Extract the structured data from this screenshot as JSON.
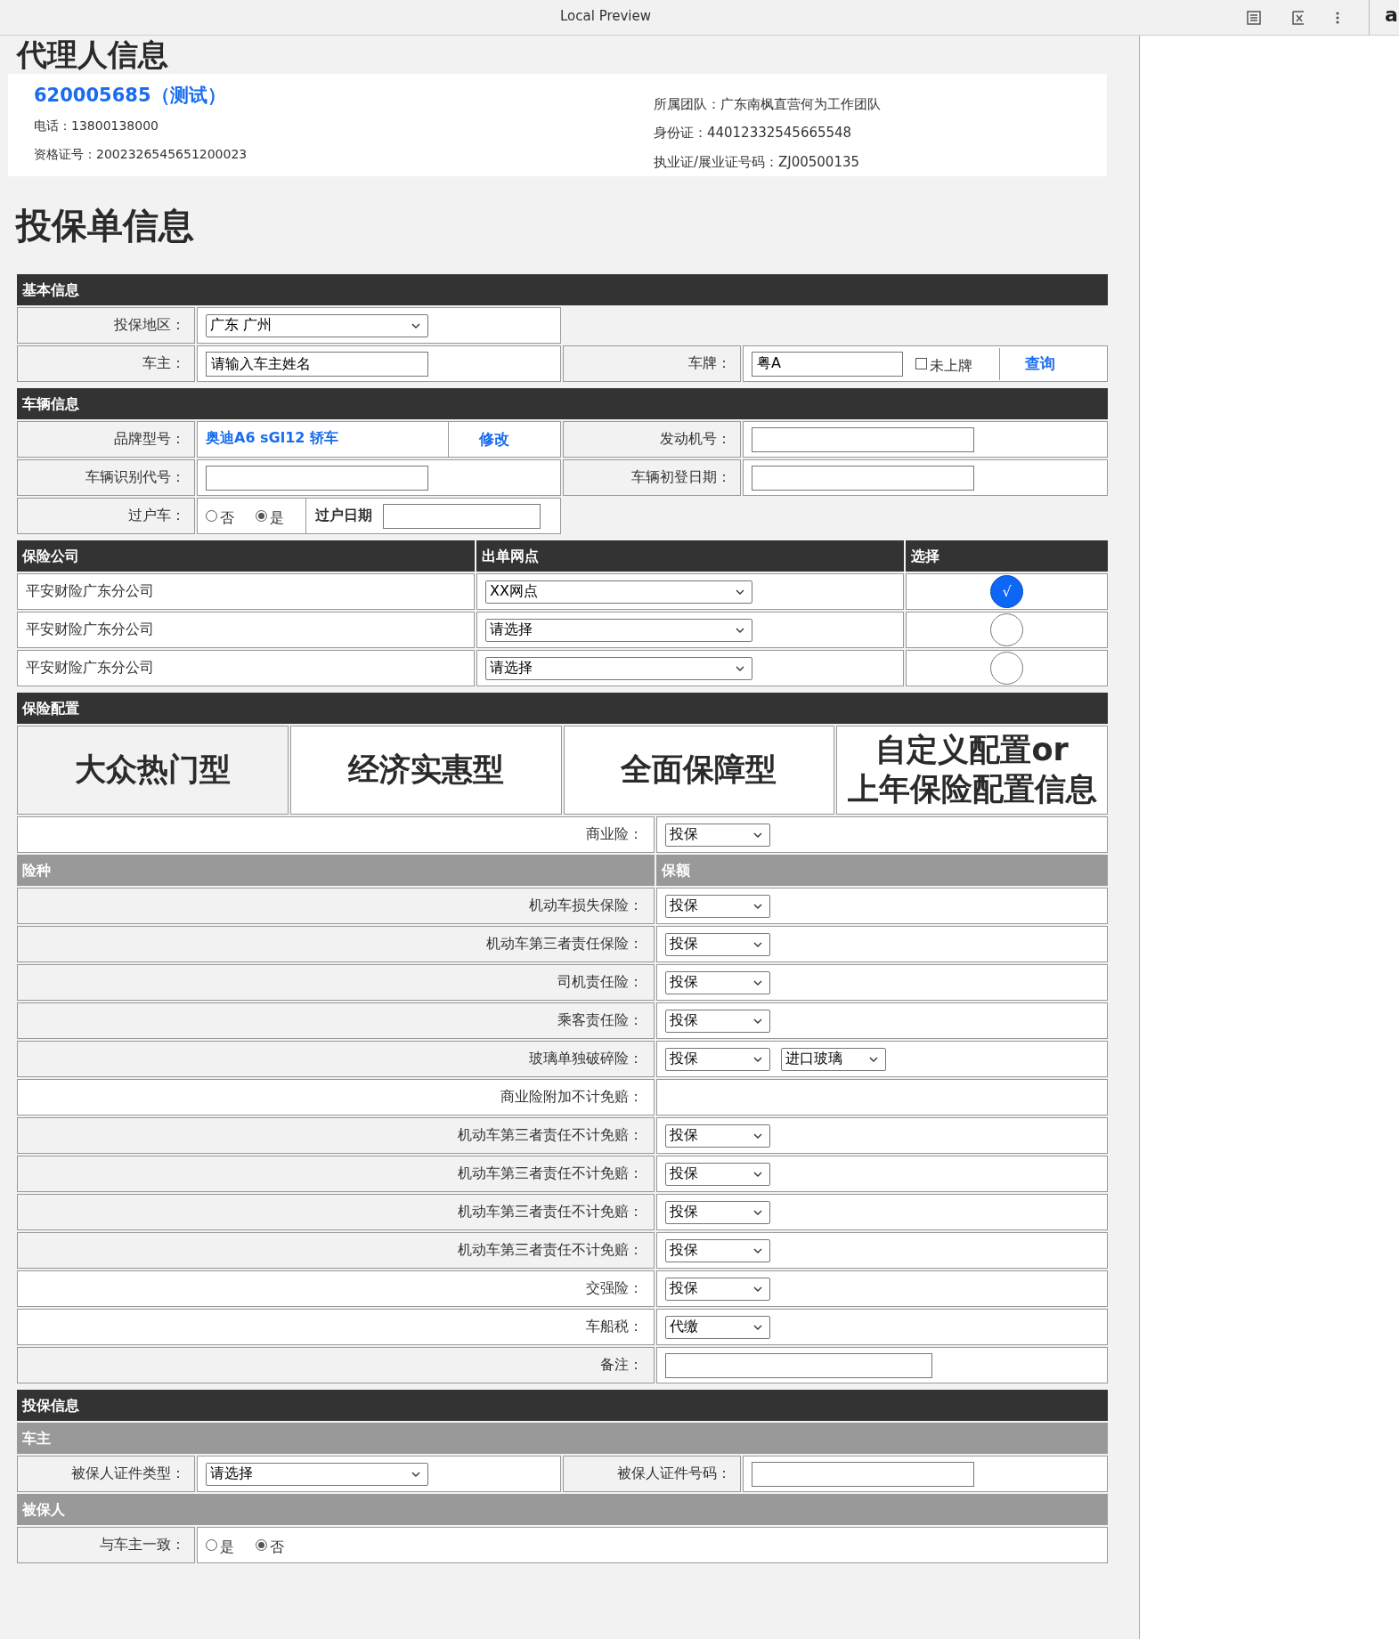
{
  "browser": {
    "title": "Local Preview",
    "avatar_letter": "a"
  },
  "agent": {
    "heading": "代理人信息",
    "name": "620005685（测试）",
    "left": [
      {
        "label": "电话：",
        "value": "13800138000"
      },
      {
        "label": "资格证号：",
        "value": "2002326545651200023"
      }
    ],
    "right": [
      {
        "label": "所属团队：",
        "value": "广东南枫直营何为工作团队"
      },
      {
        "label": "身份证：",
        "value": "44012332545665548"
      },
      {
        "label": "执业证/展业证号码：",
        "value": "ZJ00500135"
      }
    ]
  },
  "form_title": "投保单信息",
  "basic": {
    "header": "基本信息",
    "region": {
      "label": "投保地区：",
      "value": "广东 广州"
    },
    "owner": {
      "label": "车主：",
      "placeholder": "请输入车主姓名"
    },
    "plate": {
      "label": "车牌：",
      "value": "粤A",
      "unlicensed": {
        "label": "未上牌",
        "checked": false
      },
      "query": "查询"
    }
  },
  "vehicle": {
    "header": "车辆信息",
    "model": {
      "label": "品牌型号：",
      "value": "奥迪A6 sGl12 轿车",
      "edit": "修改"
    },
    "engine": {
      "label": "发动机号："
    },
    "vin": {
      "label": "车辆识别代号："
    },
    "reg_date": {
      "label": "车辆初登日期："
    },
    "transfer": {
      "label": "过户车：",
      "options": [
        {
          "label": "否",
          "selected": false
        },
        {
          "label": "是",
          "selected": true
        }
      ],
      "date_label": "过户日期"
    }
  },
  "companies": {
    "columns": [
      "保险公司",
      "出单网点",
      "选择"
    ],
    "mark": "√",
    "rows": [
      {
        "name": "平安财险广东分公司",
        "outlet": "XX网点",
        "selected": true
      },
      {
        "name": "平安财险广东分公司",
        "outlet": "请选择",
        "selected": false
      },
      {
        "name": "平安财险广东分公司",
        "outlet": "请选择",
        "selected": false
      }
    ]
  },
  "config": {
    "header": "保险配置",
    "presets": [
      {
        "label": "大众热门型",
        "selected": true
      },
      {
        "label": "经济实惠型",
        "selected": false
      },
      {
        "label": "全面保障型",
        "selected": false
      },
      {
        "label": "自定义配置or\n上年保险配置信息",
        "selected": false
      }
    ],
    "rows": [
      {
        "kind": "group",
        "label": "商业险：",
        "value": "投保"
      },
      {
        "kind": "header",
        "label": "险种",
        "value": "保额"
      },
      {
        "kind": "item",
        "label": "机动车损失保险：",
        "value": "投保"
      },
      {
        "kind": "item",
        "label": "机动车第三者责任保险：",
        "value": "投保"
      },
      {
        "kind": "item",
        "label": "司机责任险：",
        "value": "投保"
      },
      {
        "kind": "item",
        "label": "乘客责任险：",
        "value": "投保"
      },
      {
        "kind": "item",
        "label": "玻璃单独破碎险：",
        "value": "投保",
        "extra": "进口玻璃"
      },
      {
        "kind": "group",
        "label": "商业险附加不计免赔："
      },
      {
        "kind": "item",
        "label": "机动车第三者责任不计免赔：",
        "value": "投保"
      },
      {
        "kind": "item",
        "label": "机动车第三者责任不计免赔：",
        "value": "投保"
      },
      {
        "kind": "item",
        "label": "机动车第三者责任不计免赔：",
        "value": "投保"
      },
      {
        "kind": "item",
        "label": "机动车第三者责任不计免赔：",
        "value": "投保"
      },
      {
        "kind": "group",
        "label": "交强险：",
        "value": "投保"
      },
      {
        "kind": "group",
        "label": "车船税：",
        "value": "代缴"
      },
      {
        "kind": "note",
        "label": "备注："
      }
    ]
  },
  "applicant": {
    "header": "投保信息",
    "owner_header": "车主",
    "id_type": {
      "label": "被保人证件类型：",
      "value": "请选择"
    },
    "id_no": {
      "label": "被保人证件号码："
    },
    "insured_header": "被保人",
    "same": {
      "label": "与车主一致：",
      "options": [
        {
          "label": "是",
          "selected": false
        },
        {
          "label": "否",
          "selected": true
        }
      ]
    }
  }
}
